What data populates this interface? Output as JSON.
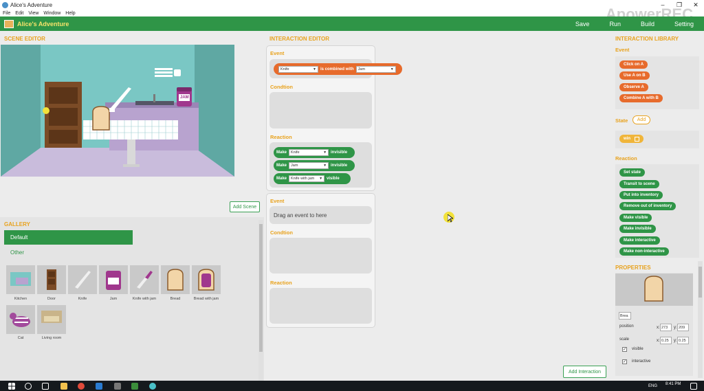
{
  "window": {
    "title": "Alice's Adventure",
    "controls": [
      "–",
      "❐",
      "✕"
    ]
  },
  "menu": [
    "File",
    "Edit",
    "View",
    "Window",
    "Help"
  ],
  "watermark": "ApowerREC",
  "topbar": {
    "app_title": "Alice's Adventure",
    "nav": [
      "Save",
      "Run",
      "Build",
      "Setting"
    ]
  },
  "scene_editor": {
    "title": "SCENE EDITOR",
    "add_scene": "Add Scene",
    "jam_label": "JAM"
  },
  "gallery": {
    "title": "GALLERY",
    "categories": [
      "Default",
      "Other"
    ],
    "items": [
      {
        "label": "Kitchen",
        "icon": "kitchen-icon"
      },
      {
        "label": "Door",
        "icon": "door-icon"
      },
      {
        "label": "Knife",
        "icon": "knife-icon"
      },
      {
        "label": "Jam",
        "icon": "jam-icon"
      },
      {
        "label": "Knife with jam",
        "icon": "knife-with-jam-icon"
      },
      {
        "label": "Bread",
        "icon": "bread-icon"
      },
      {
        "label": "Bread with jam",
        "icon": "bread-with-jam-icon"
      },
      {
        "label": "Cat",
        "icon": "cat-icon"
      },
      {
        "label": "Living room",
        "icon": "living-room-icon"
      }
    ]
  },
  "interaction_editor": {
    "title": "INTERACTION EDITOR",
    "block1": {
      "event_label": "Event",
      "event": {
        "a": "Knife",
        "connector": "is combined with",
        "b": "Jam"
      },
      "condition_label": "Condtion",
      "reaction_label": "Reaction",
      "reactions": [
        {
          "verb": "Make",
          "object": "Knife",
          "state": "invisible"
        },
        {
          "verb": "Make",
          "object": "Jam",
          "state": "invisible"
        },
        {
          "verb": "Make",
          "object": "Knife with jam",
          "state": "visible"
        }
      ]
    },
    "block2": {
      "event_label": "Event",
      "event_placeholder": "Drag an event to here",
      "condition_label": "Condtion",
      "reaction_label": "Reaction"
    },
    "add_interaction": "Add Interaction"
  },
  "library": {
    "title": "INTERACTION LIBRARY",
    "event_label": "Event",
    "events": [
      "Click on A",
      "Use A on B",
      "Observe A",
      "Combine A with B"
    ],
    "state_label": "State",
    "state_add": "Add",
    "states": [
      "win"
    ],
    "reaction_label": "Reaction",
    "reactions": [
      "Set state",
      "Transit to scene",
      "Put into inventory",
      "Remove out of inventory",
      "Make visible",
      "Make invisible",
      "Make interactive",
      "Make non-interactive"
    ]
  },
  "properties": {
    "title": "PROPERTIES",
    "name_value": "Brea",
    "position_label": "position",
    "pos_x": "273",
    "pos_y": "209",
    "scale_label": "scale",
    "scale_x": "0.25",
    "scale_y": "0.25",
    "x_label": "x:",
    "y_label": "y:",
    "visible_label": "visible",
    "interactive_label": "interactive",
    "visible": true,
    "interactive": true
  },
  "taskbar": {
    "time": "8:41 PM",
    "lang": "ENG"
  },
  "colors": {
    "green": "#2f9547",
    "orange": "#e76b2c",
    "accent": "#e8a21d"
  }
}
